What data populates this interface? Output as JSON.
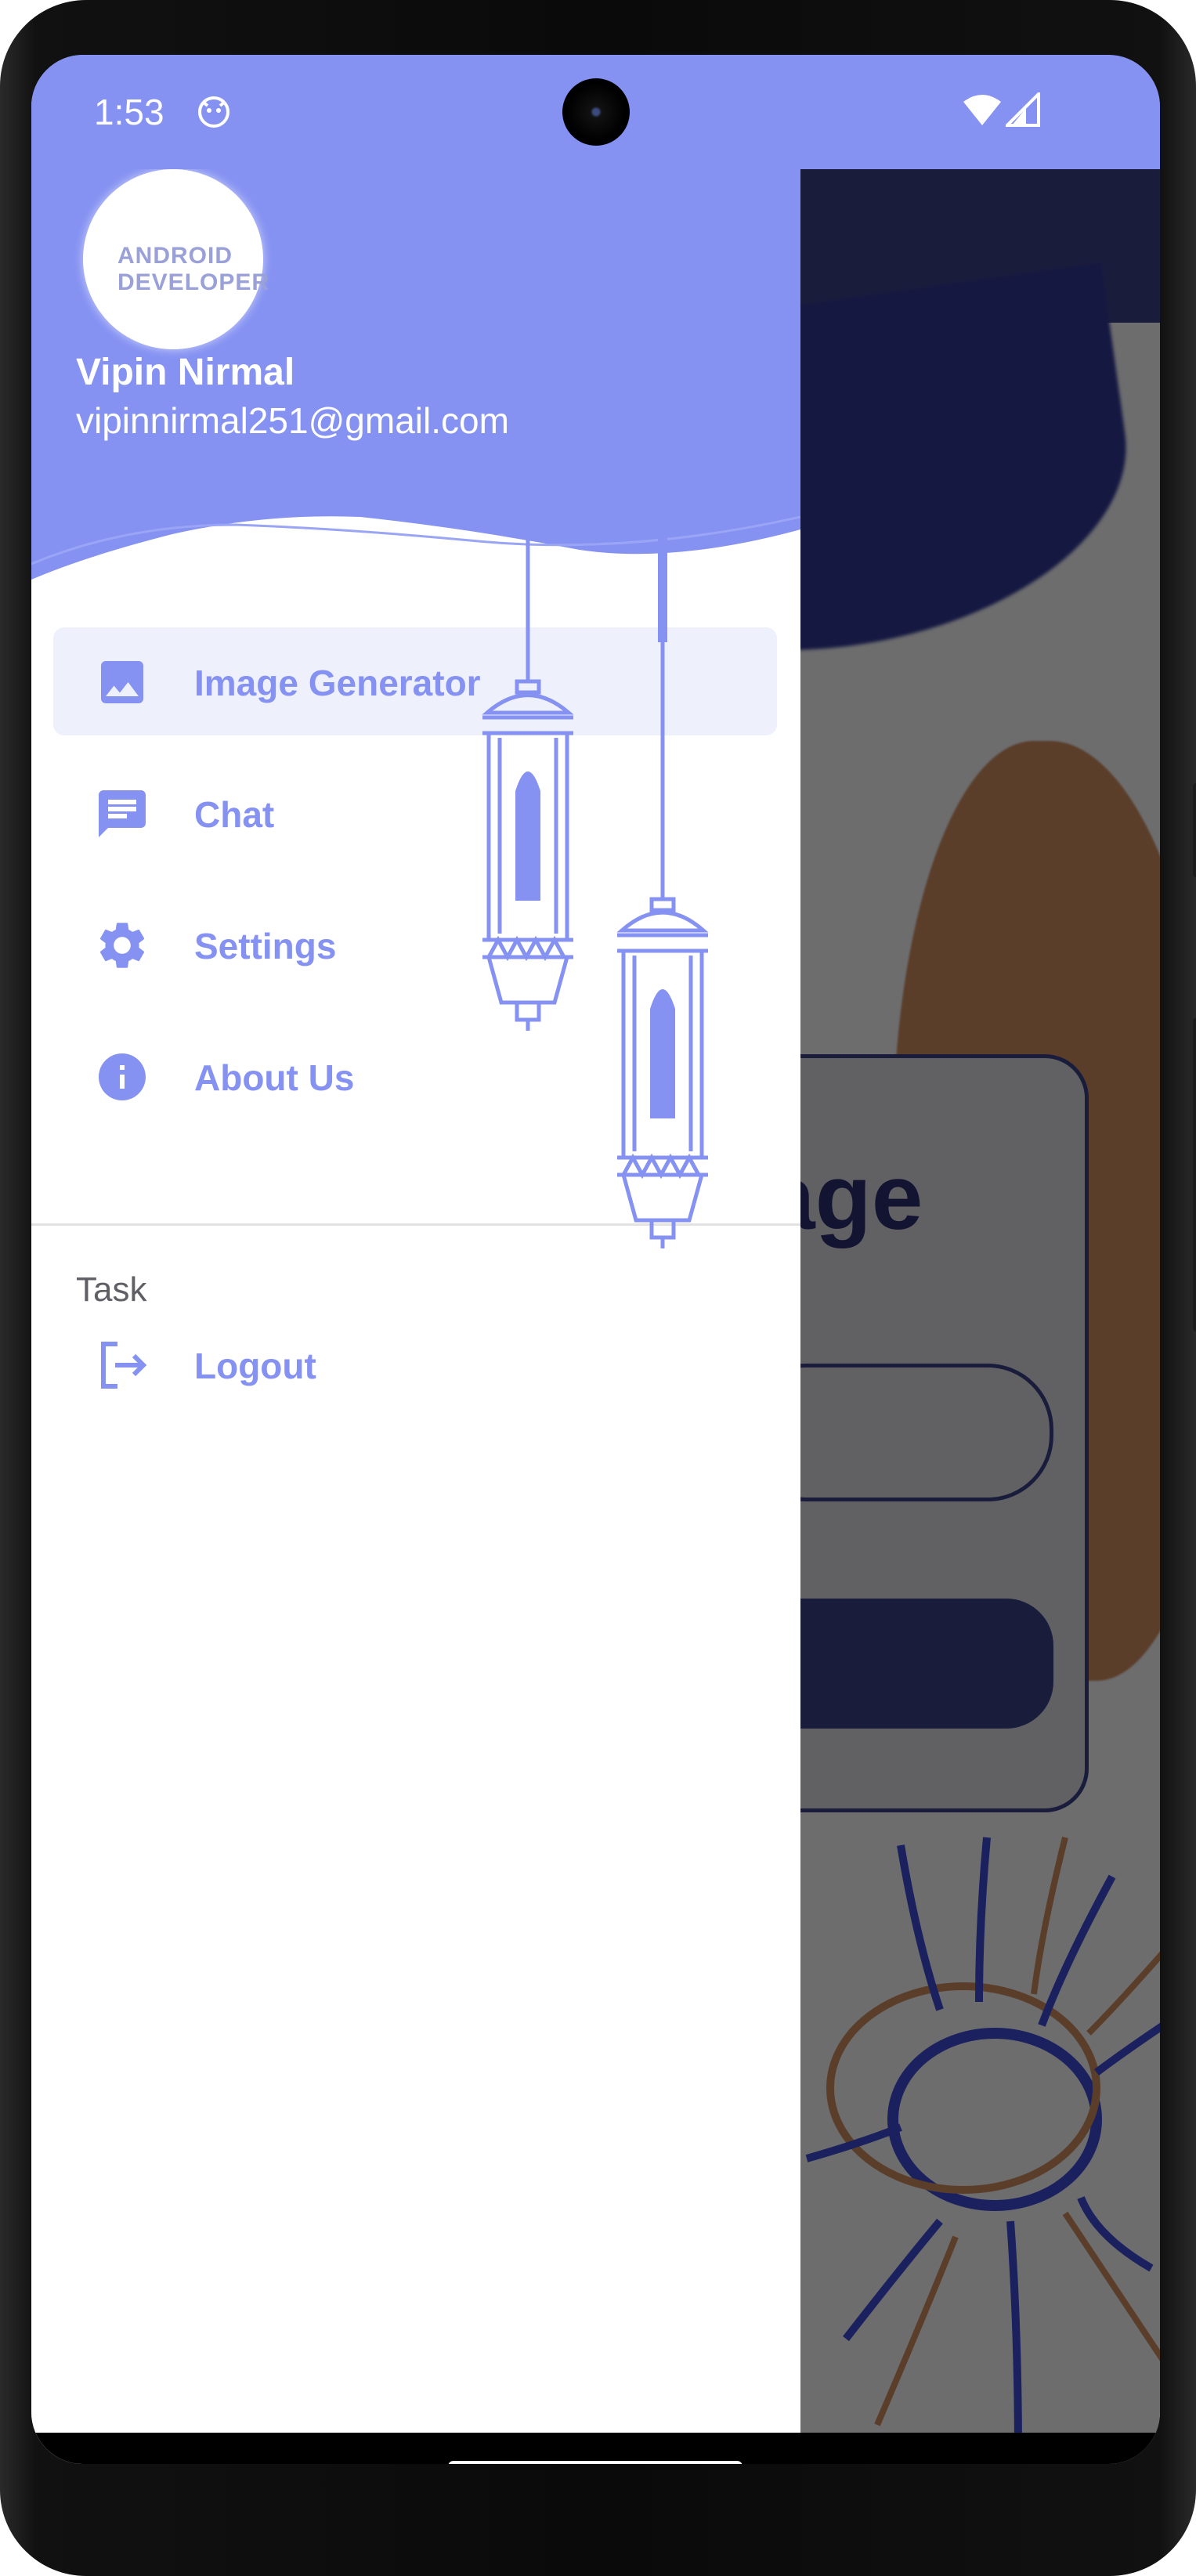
{
  "status_bar": {
    "time": "1:53",
    "icons": [
      "notification-app-icon",
      "wifi-icon",
      "cellular-signal-icon"
    ]
  },
  "drawer": {
    "header": {
      "avatar_text": "ANDROID DEVELOPER",
      "user_name": "Vipin Nirmal",
      "user_email": "vipinnirmal251@gmail.com"
    },
    "items": [
      {
        "label": "Image Generator",
        "icon": "image-icon",
        "active": true
      },
      {
        "label": "Chat",
        "icon": "chat-icon",
        "active": false
      },
      {
        "label": "Settings",
        "icon": "gear-icon",
        "active": false
      },
      {
        "label": "About Us",
        "icon": "info-icon",
        "active": false
      }
    ],
    "section_title": "Task",
    "logout_label": "Logout"
  },
  "background_screen": {
    "partial_title": "age"
  },
  "colors": {
    "accent": "#8592f2",
    "active_item_bg": "#eef0fc",
    "dark_primary": "#3b3f86",
    "orange": "#c98a5e"
  }
}
